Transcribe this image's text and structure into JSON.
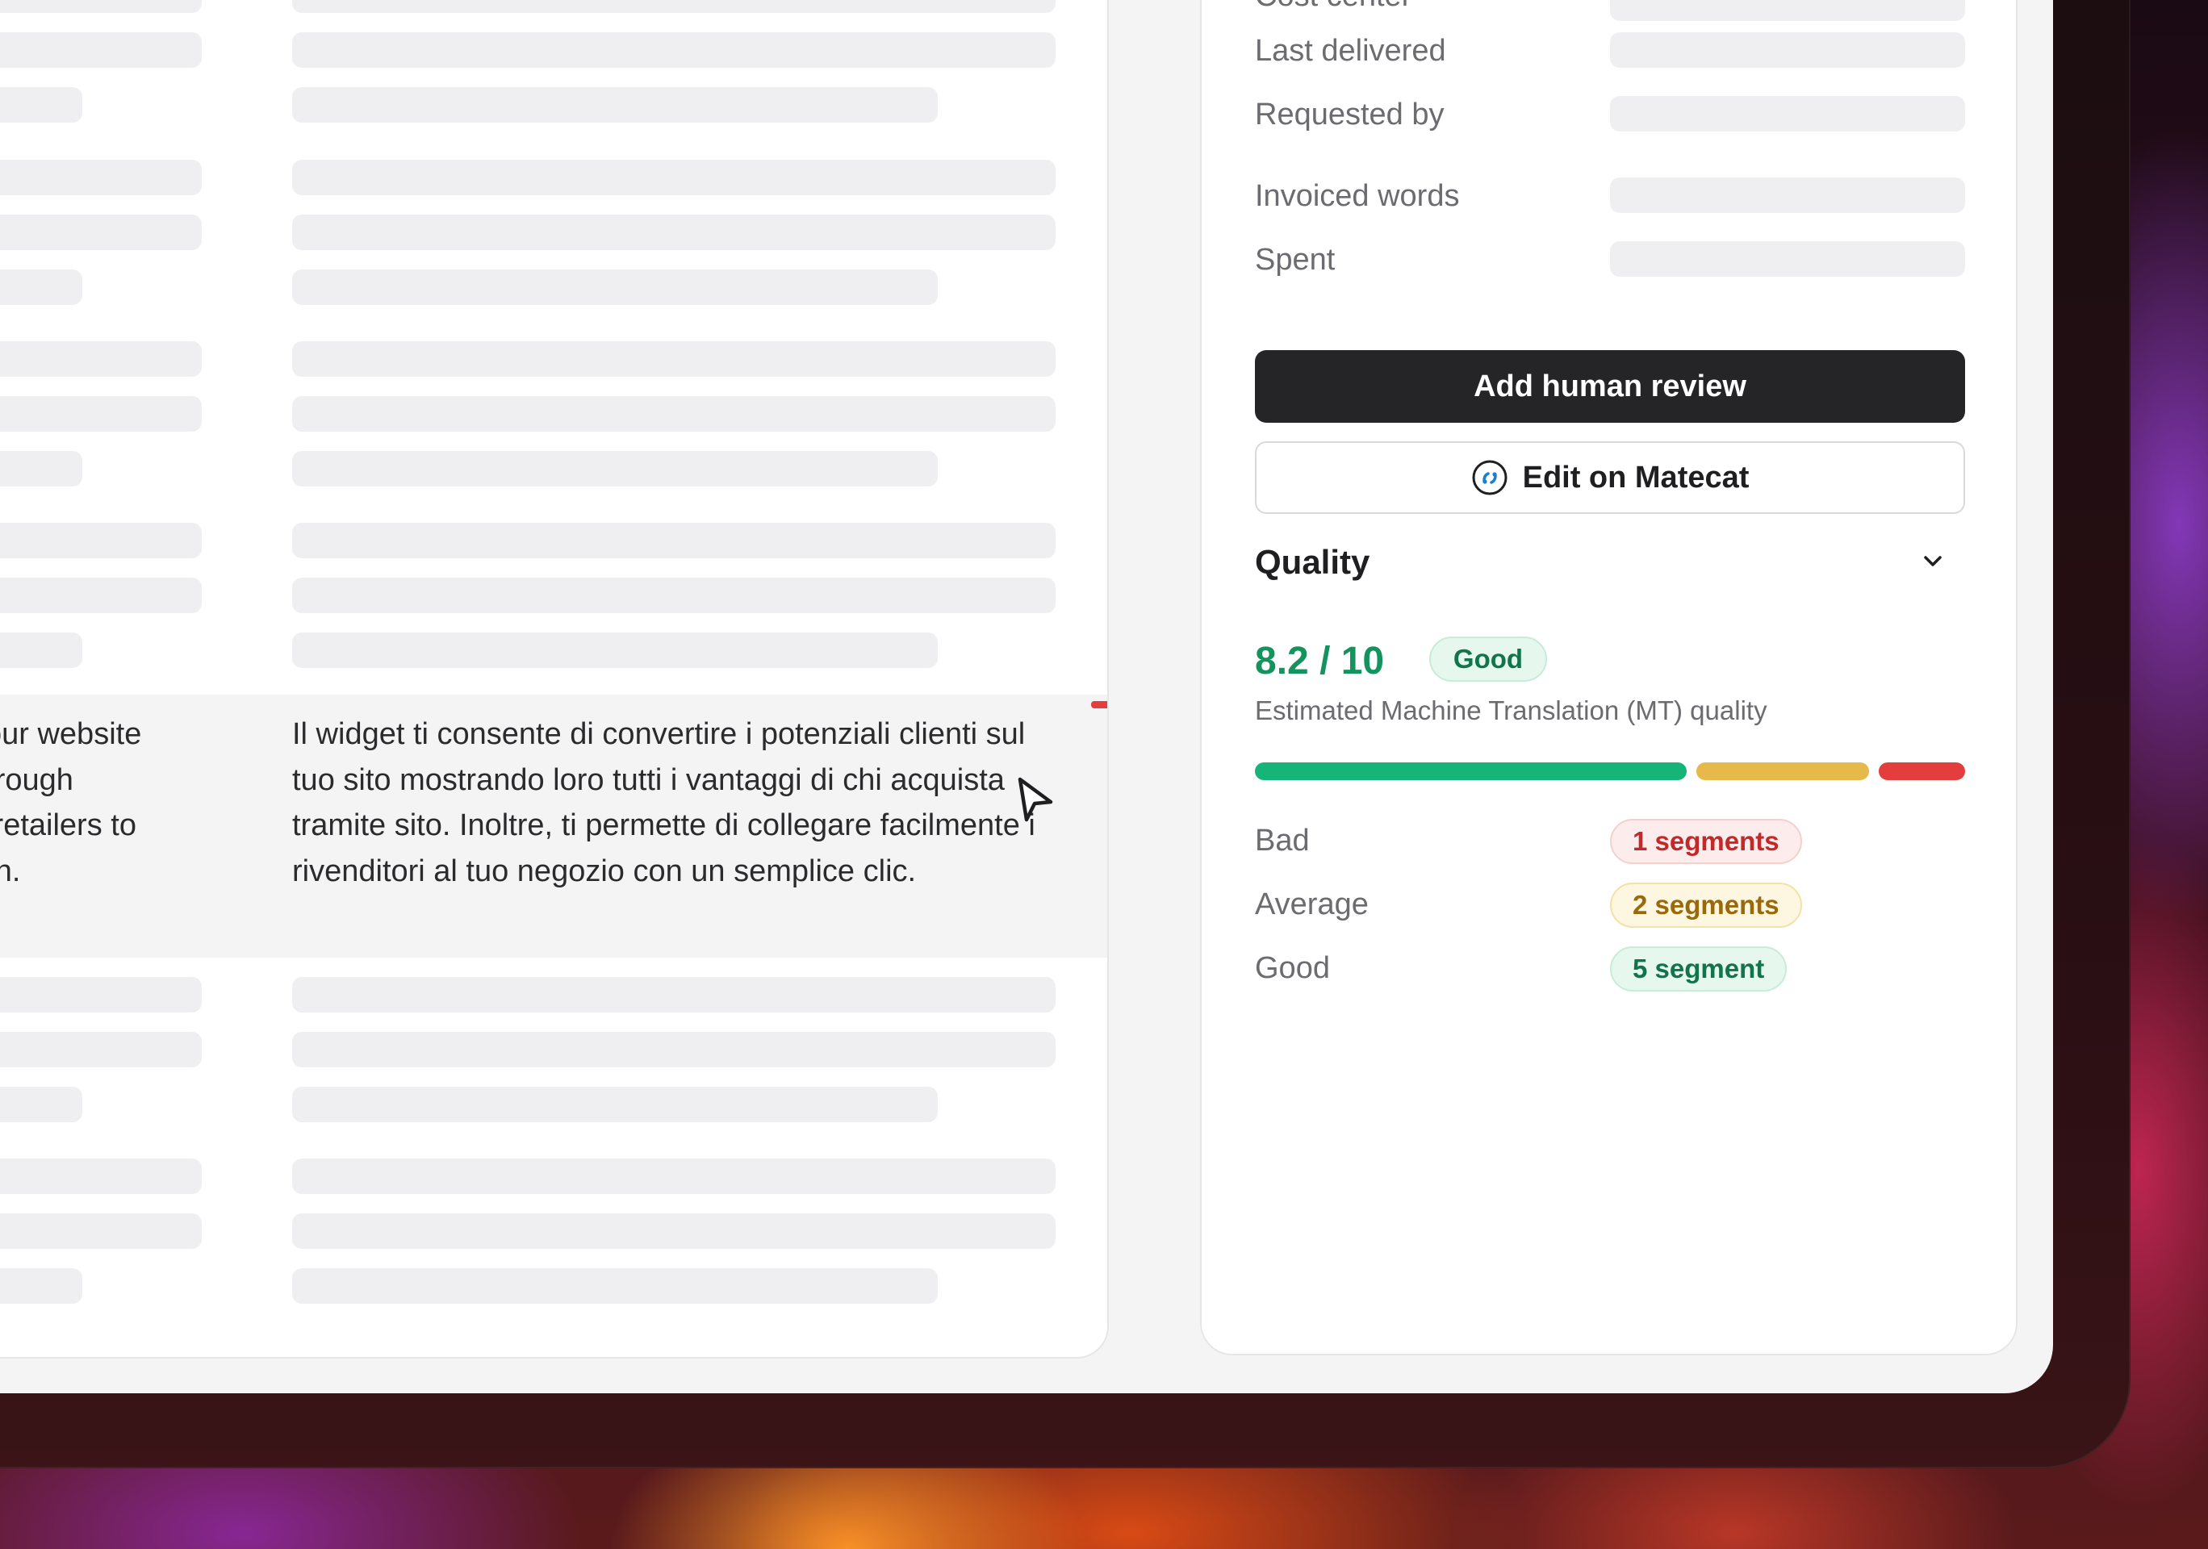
{
  "editor": {
    "source_segment_lines": [
      "your website",
      "through",
      "k retailers to",
      "ton."
    ],
    "target_segment": "Il widget ti consente di convertire i potenziali clienti sul tuo sito mostrando loro tutti i vantaggi di chi acquista tramite sito. Inoltre, ti permette di collegare facilmente i rivenditori al tuo negozio con un semplice clic."
  },
  "details": {
    "fields": [
      {
        "label": "Cost center"
      },
      {
        "label": "Last delivered"
      },
      {
        "label": "Requested by"
      },
      {
        "label": "Invoiced words"
      },
      {
        "label": "Spent"
      }
    ],
    "add_review_label": "Add human review",
    "edit_matecat_label": "Edit on Matecat"
  },
  "quality": {
    "title": "Quality",
    "score": "8.2 / 10",
    "score_badge": "Good",
    "subtitle": "Estimated Machine Translation (MT) quality",
    "bar": {
      "good_fraction": 0.625,
      "average_fraction": 0.25,
      "bad_fraction": 0.125
    },
    "rows": [
      {
        "label": "Bad",
        "badge": "1 segments"
      },
      {
        "label": "Average",
        "badge": "2 segments"
      },
      {
        "label": "Good",
        "badge": "5 segment"
      }
    ],
    "colors": {
      "good": "#17b47a",
      "average": "#e6b94a",
      "bad": "#e43d3d",
      "score": "#14935f"
    }
  }
}
